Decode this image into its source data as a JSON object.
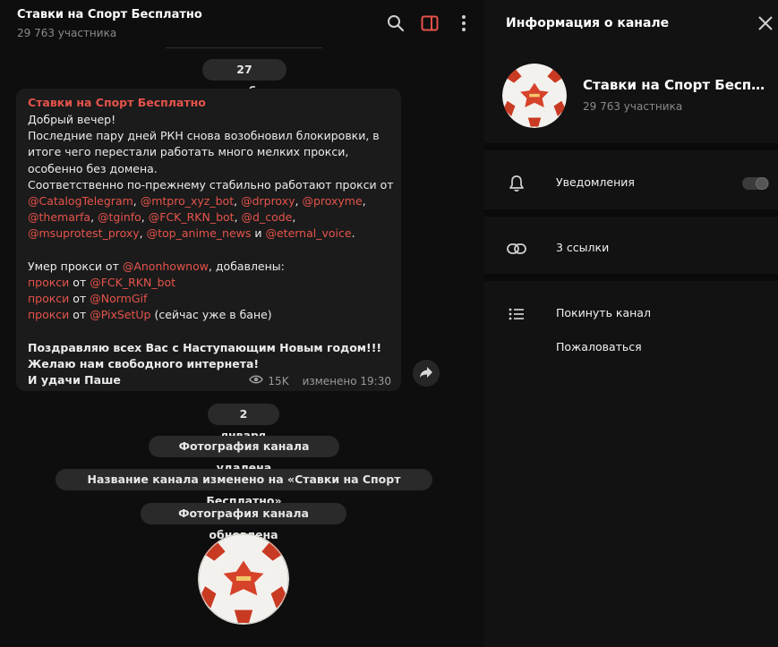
{
  "chat": {
    "title": "Ставки на Спорт Бесплатно",
    "subtitle": "29 763 участника",
    "date1": "27 декабря",
    "date2": "2 января",
    "message": {
      "author": "Ставки на Спорт Бесплатно",
      "greeting": "Добрый вечер!",
      "p1": "Последние пару дней РКН снова возобновил блокировки, в итоге чего перестали работать много мелких прокси, особенно без домена.",
      "p2_intro": "Соответственно по-прежнему стабильно работают прокси от ",
      "links": [
        "@CatalogTelegram",
        "@mtpro_xyz_bot",
        "@drproxy",
        "@proxyme",
        "@themarfa",
        "@tginfo",
        "@FCK_RKN_bot",
        "@d_code",
        "@msuprotest_proxy",
        "@top_anime_news",
        "@eternal_voice"
      ],
      "and_word": "и",
      "died_text": "Умер прокси от ",
      "died_link": "@Anonhownow",
      "added_text": ", добавлены:",
      "proxy_word": "прокси",
      "from_word": "от",
      "added_links": [
        "@FCK_RKN_bot",
        "@NormGif",
        "@PixSetUp"
      ],
      "banned_note": "(сейчас уже в бане)",
      "bold1": "Поздравляю всех Вас с Наступающим Новым годом!!!",
      "bold2": "Желаю нам свободного интернета!",
      "bold3": "И удачи Паше",
      "views": "15K",
      "edited": "изменено 19:30"
    },
    "service1": "Фотография канала удалена",
    "service2": "Название канала изменено на «Ставки на Спорт Бесплатно»",
    "service3": "Фотография канала обновлена",
    "icons": [
      "search-icon",
      "sidebar-toggle-icon",
      "more-icon",
      "eye-icon",
      "forward-icon"
    ]
  },
  "panel": {
    "title": "Информация о канале",
    "channel_name": "Ставки на Спорт Бесплатно",
    "members": "29 763 участника",
    "notifications": "Уведомления",
    "links": "3 ссылки",
    "leave": "Покинуть канал",
    "report": "Пожаловаться",
    "icons": [
      "close-icon",
      "bell-icon",
      "link-icon",
      "list-icon"
    ]
  },
  "colors": {
    "accent": "#e5534b",
    "bg": "#0e0e0e",
    "bubble": "#1b1b1b"
  }
}
